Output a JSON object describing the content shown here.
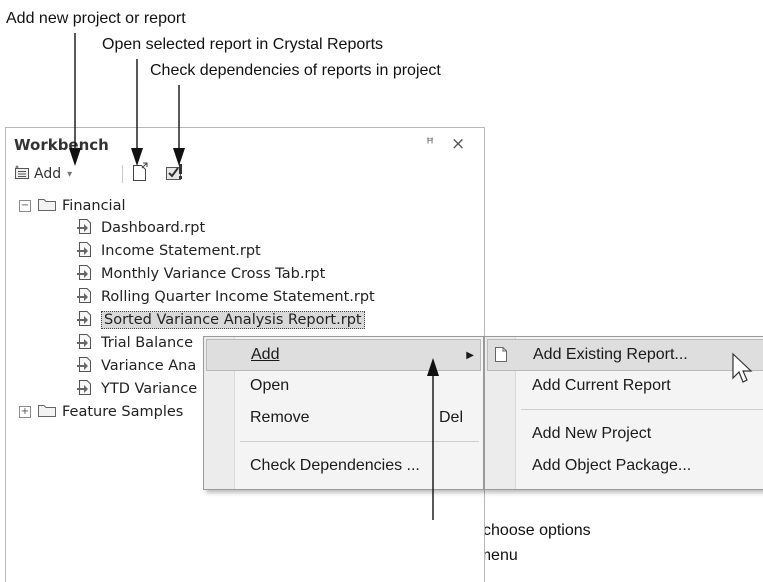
{
  "callouts": {
    "add": "Add new project or report",
    "open": "Open selected report in Crystal Reports",
    "check": "Check dependencies of reports in project",
    "rightclick_line1": "Right-click to choose options",
    "rightclick_line2": "from pop-up menu"
  },
  "workbench": {
    "title": "Workbench",
    "pin_glyph": "ꟸ",
    "close_glyph": "×",
    "toolbar": {
      "add_label": "Add",
      "add_caret": "▾"
    },
    "tree": {
      "financial": {
        "label": "Financial",
        "expander": "−",
        "items": [
          "Dashboard.rpt",
          "Income Statement.rpt",
          "Monthly Variance Cross Tab.rpt",
          "Rolling Quarter Income Statement.rpt",
          "Sorted Variance Analysis Report.rpt",
          "Trial Balance",
          "Variance Ana",
          "YTD Variance"
        ]
      },
      "samples": {
        "label": "Feature Samples",
        "expander": "+"
      }
    }
  },
  "context_menu": {
    "add": "Add",
    "add_arrow": "▶",
    "open": "Open",
    "remove": "Remove",
    "remove_shortcut": "Del",
    "check": "Check Dependencies ..."
  },
  "submenu": {
    "existing": "Add Existing Report...",
    "current": "Add Current Report",
    "new_project": "Add New Project",
    "object_package": "Add Object Package..."
  },
  "icons": {
    "pin": "pin-icon",
    "close": "close-icon",
    "add": "add-icon",
    "open": "open-report-icon",
    "check": "check-dependencies-icon",
    "folder": "folder-icon",
    "report": "report-icon",
    "cursor": "mouse-cursor-icon"
  }
}
